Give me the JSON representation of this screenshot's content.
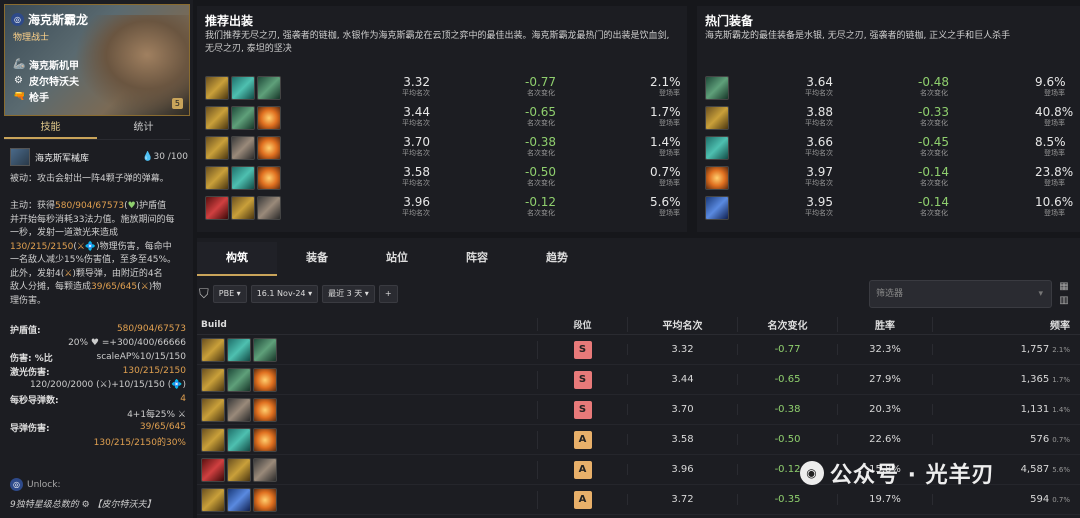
{
  "champion": {
    "name": "海克斯霸龙",
    "role": "物理战士",
    "cost": "5",
    "traits": [
      {
        "icon": "🦾",
        "name": "海克斯机甲"
      },
      {
        "icon": "⚙",
        "name": "皮尔特沃夫"
      },
      {
        "icon": "🔫",
        "name": "枪手"
      }
    ]
  },
  "left_tabs": [
    "技能",
    "统计"
  ],
  "ability": {
    "name": "海克斯军械库",
    "mana": "30 /100",
    "passive": "被动：攻击会射出一阵4颗子弹的弹幕。",
    "active_lines": [
      {
        "parts": [
          [
            "主动：获得",
            ""
          ],
          [
            "580/904/67573",
            "o"
          ],
          [
            "(",
            ""
          ],
          [
            "♥",
            "g"
          ],
          [
            ")护盾值",
            ""
          ]
        ]
      },
      {
        "parts": [
          [
            "并开始每秒消耗33法力值。施放期间的每",
            ""
          ]
        ]
      },
      {
        "parts": [
          [
            "一秒，发射一道激光来造成",
            ""
          ]
        ]
      },
      {
        "parts": [
          [
            "130/215/2150",
            "o"
          ],
          [
            "(",
            ""
          ],
          [
            "⚔",
            "o"
          ],
          [
            "💠",
            "g"
          ],
          [
            ")物理伤害，每命中",
            ""
          ]
        ]
      },
      {
        "parts": [
          [
            "一名敌人减少15%伤害值，至多至45%。",
            ""
          ]
        ]
      },
      {
        "parts": [
          [
            "此外，发射4(",
            ""
          ],
          [
            "⚔",
            "o"
          ],
          [
            ")颗导弹，由附近的4名",
            ""
          ]
        ]
      },
      {
        "parts": [
          [
            "敌人分摊，每颗造成",
            ""
          ],
          [
            "39/65/645",
            "o"
          ],
          [
            "(",
            ""
          ],
          [
            "⚔",
            "o"
          ],
          [
            ")物",
            ""
          ]
        ]
      },
      {
        "parts": [
          [
            "理伤害。",
            ""
          ]
        ]
      }
    ]
  },
  "stats": [
    {
      "label": "护盾值:",
      "value": "580/904/67573",
      "style": "o"
    },
    {
      "label": "",
      "value": "20% ♥ =+300/400/66666",
      "style": "w"
    },
    {
      "label": "伤害: %比",
      "value": "scaleAP%10/15/150",
      "style": "w"
    },
    {
      "label": "激光伤害:",
      "value": "130/215/2150",
      "style": "o"
    },
    {
      "label": "",
      "value": "120/200/2000 (⚔)+10/15/150 (💠)",
      "style": "w"
    },
    {
      "label": "每秒导弹数:",
      "value": "4",
      "style": "o"
    },
    {
      "label": "",
      "value": "4+1每25% ⚔",
      "style": "w"
    },
    {
      "label": "导弹伤害:",
      "value": "39/65/645",
      "style": "o"
    },
    {
      "label": "",
      "value": "130/215/2150的30%",
      "style": "o"
    }
  ],
  "unlock": {
    "title": "Unlock:",
    "desc": "9独特星级总数的 ⚙ 【皮尔特沃夫】"
  },
  "recommended": {
    "title": "推荐出装",
    "desc": "我们推荐无尽之刃, 强袭者的链枷, 水银作为海克斯霸龙在云顶之弈中的最佳出装。海克斯霸龙最热门的出装是饮血剑, 无尽之刃, 泰坦的坚决",
    "rows": [
      {
        "icons": [
          "sword",
          "teal",
          "green"
        ],
        "avg": "3.32",
        "chg": "-0.77",
        "rate": "2.1%"
      },
      {
        "icons": [
          "sword",
          "green",
          "fire"
        ],
        "avg": "3.44",
        "chg": "-0.65",
        "rate": "1.7%"
      },
      {
        "icons": [
          "sword",
          "chain",
          "fire"
        ],
        "avg": "3.70",
        "chg": "-0.38",
        "rate": "1.4%"
      },
      {
        "icons": [
          "sword",
          "teal",
          "fire"
        ],
        "avg": "3.58",
        "chg": "-0.50",
        "rate": "0.7%"
      },
      {
        "icons": [
          "red",
          "sword",
          "chain"
        ],
        "avg": "3.96",
        "chg": "-0.12",
        "rate": "5.6%"
      }
    ]
  },
  "hot": {
    "title": "热门装备",
    "desc": "海克斯霸龙的最佳装备是水银, 无尽之刃, 强袭者的链枷, 正义之手和巨人杀手",
    "rows": [
      {
        "icon": "green",
        "avg": "3.64",
        "chg": "-0.48",
        "rate": "9.6%"
      },
      {
        "icon": "sword",
        "avg": "3.88",
        "chg": "-0.33",
        "rate": "40.8%"
      },
      {
        "icon": "teal",
        "avg": "3.66",
        "chg": "-0.45",
        "rate": "8.5%"
      },
      {
        "icon": "fire",
        "avg": "3.97",
        "chg": "-0.14",
        "rate": "23.8%"
      },
      {
        "icon": "blue",
        "avg": "3.95",
        "chg": "-0.14",
        "rate": "10.6%"
      }
    ]
  },
  "labels": {
    "avg": "平均名次",
    "chg": "名次变化",
    "rate": "登场率"
  },
  "bottom_tabs": [
    "构筑",
    "装备",
    "站位",
    "阵容",
    "趋势"
  ],
  "filters": {
    "set": "PBE ▾",
    "patch": "16.1 Nov-24 ▾",
    "range": "最近 3 天 ▾",
    "add": "+",
    "search_placeholder": "筛选器"
  },
  "table": {
    "headers": [
      "Build",
      "段位",
      "平均名次",
      "名次变化",
      "胜率",
      "频率"
    ],
    "rows": [
      {
        "icons": [
          "sword",
          "teal",
          "green"
        ],
        "tier": "S",
        "avg": "3.32",
        "chg": "-0.77",
        "win": "32.3%",
        "freq": "1,757",
        "freq_pct": "2.1%"
      },
      {
        "icons": [
          "sword",
          "green",
          "fire"
        ],
        "tier": "S",
        "avg": "3.44",
        "chg": "-0.65",
        "win": "27.9%",
        "freq": "1,365",
        "freq_pct": "1.7%"
      },
      {
        "icons": [
          "sword",
          "chain",
          "fire"
        ],
        "tier": "S",
        "avg": "3.70",
        "chg": "-0.38",
        "win": "20.3%",
        "freq": "1,131",
        "freq_pct": "1.4%"
      },
      {
        "icons": [
          "sword",
          "teal",
          "fire"
        ],
        "tier": "A",
        "avg": "3.58",
        "chg": "-0.50",
        "win": "22.6%",
        "freq": "576",
        "freq_pct": "0.7%"
      },
      {
        "icons": [
          "red",
          "sword",
          "chain"
        ],
        "tier": "A",
        "avg": "3.96",
        "chg": "-0.12",
        "win": "15.8%",
        "freq": "4,587",
        "freq_pct": "5.6%"
      },
      {
        "icons": [
          "sword",
          "blue",
          "fire"
        ],
        "tier": "A",
        "avg": "3.72",
        "chg": "-0.35",
        "win": "19.7%",
        "freq": "594",
        "freq_pct": "0.7%"
      }
    ]
  },
  "watermark": "公众号 · 光羊刃"
}
